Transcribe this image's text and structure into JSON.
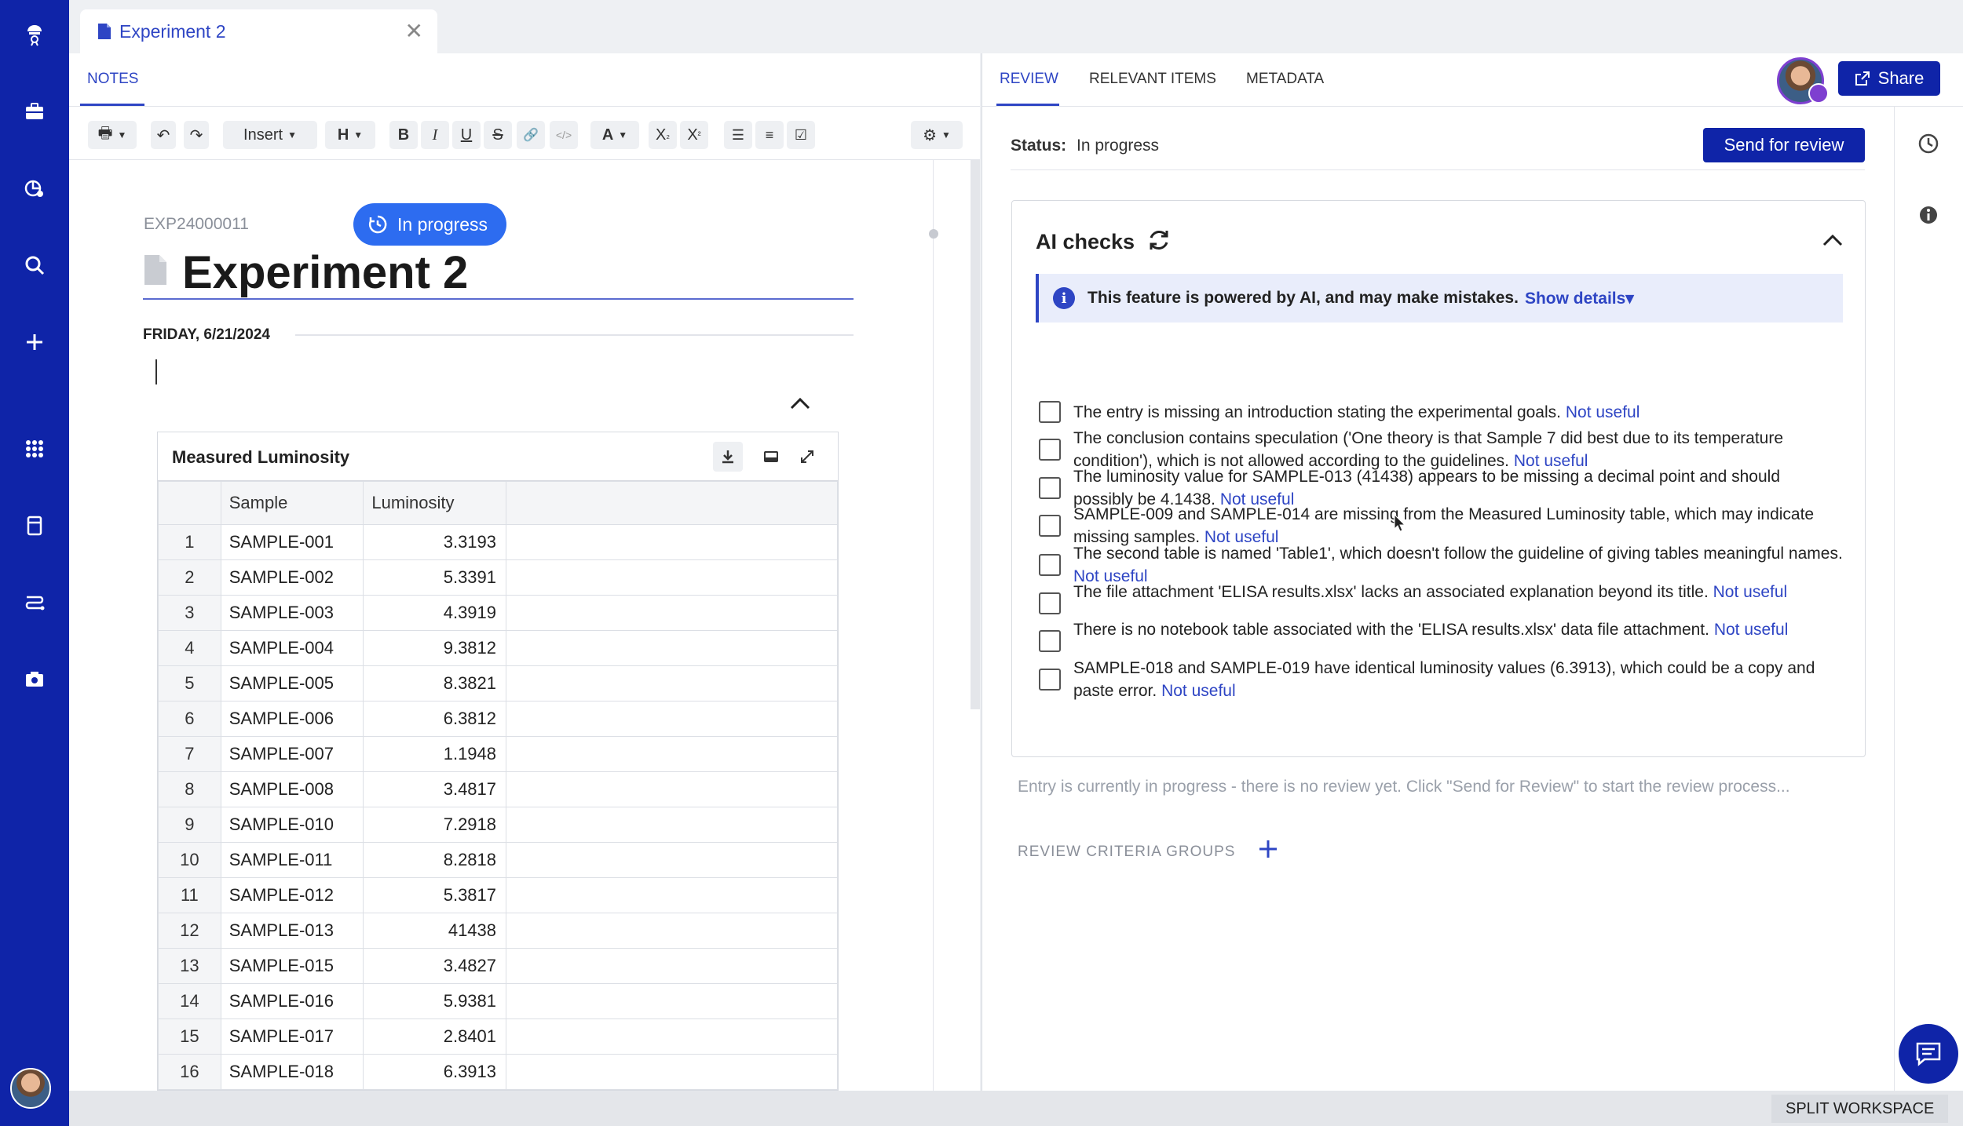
{
  "tab": {
    "title": "Experiment 2"
  },
  "notes": {
    "tab_label": "NOTES",
    "toolbar": {
      "insert_label": "Insert",
      "heading_label": "H",
      "font_color_label": "A"
    },
    "experiment_id": "EXP24000011",
    "status_pill": "In progress",
    "title": "Experiment 2",
    "date_label": "FRIDAY, 6/21/2024",
    "table": {
      "title": "Measured Luminosity",
      "columns": [
        "Sample",
        "Luminosity"
      ],
      "rows": [
        {
          "n": "1",
          "sample": "SAMPLE-001",
          "lum": "3.3193"
        },
        {
          "n": "2",
          "sample": "SAMPLE-002",
          "lum": "5.3391"
        },
        {
          "n": "3",
          "sample": "SAMPLE-003",
          "lum": "4.3919"
        },
        {
          "n": "4",
          "sample": "SAMPLE-004",
          "lum": "9.3812"
        },
        {
          "n": "5",
          "sample": "SAMPLE-005",
          "lum": "8.3821"
        },
        {
          "n": "6",
          "sample": "SAMPLE-006",
          "lum": "6.3812"
        },
        {
          "n": "7",
          "sample": "SAMPLE-007",
          "lum": "1.1948"
        },
        {
          "n": "8",
          "sample": "SAMPLE-008",
          "lum": "3.4817"
        },
        {
          "n": "9",
          "sample": "SAMPLE-010",
          "lum": "7.2918"
        },
        {
          "n": "10",
          "sample": "SAMPLE-011",
          "lum": "8.2818"
        },
        {
          "n": "11",
          "sample": "SAMPLE-012",
          "lum": "5.3817"
        },
        {
          "n": "12",
          "sample": "SAMPLE-013",
          "lum": "41438"
        },
        {
          "n": "13",
          "sample": "SAMPLE-015",
          "lum": "3.4827"
        },
        {
          "n": "14",
          "sample": "SAMPLE-016",
          "lum": "5.9381"
        },
        {
          "n": "15",
          "sample": "SAMPLE-017",
          "lum": "2.8401"
        },
        {
          "n": "16",
          "sample": "SAMPLE-018",
          "lum": "6.3913"
        }
      ]
    }
  },
  "review": {
    "tabs": [
      "REVIEW",
      "RELEVANT ITEMS",
      "METADATA"
    ],
    "share_label": "Share",
    "status_label": "Status:",
    "status_value": "In progress",
    "send_label": "Send for review",
    "ai": {
      "title": "AI checks",
      "banner_text": "This feature is powered by AI, and may make mistakes.",
      "banner_link": "Show details",
      "items": [
        {
          "text": "The entry is missing an introduction stating the experimental goals.",
          "link": "Not useful"
        },
        {
          "text": "The conclusion contains speculation ('One theory is that Sample 7 did best due to its temperature condition'), which is not allowed according to the guidelines.",
          "link": "Not useful"
        },
        {
          "text": "The luminosity value for SAMPLE-013 (41438) appears to be missing a decimal point and should possibly be 4.1438.",
          "link": "Not useful"
        },
        {
          "text": "SAMPLE-009 and SAMPLE-014 are missing from the Measured Luminosity table, which may indicate missing samples.",
          "link": "Not useful"
        },
        {
          "text": "The second table is named 'Table1', which doesn't follow the guideline of giving tables meaningful names.",
          "link": "Not useful"
        },
        {
          "text": "The file attachment 'ELISA results.xlsx' lacks an associated explanation beyond its title.",
          "link": "Not useful"
        },
        {
          "text": "There is no notebook table associated with the 'ELISA results.xlsx' data file attachment.",
          "link": "Not useful"
        },
        {
          "text": "SAMPLE-018 and SAMPLE-019 have identical luminosity values (6.3913), which could be a copy and paste error.",
          "link": "Not useful"
        }
      ]
    },
    "no_review_text": "Entry is currently in progress - there is no review yet. Click \"Send for Review\" to start the review process...",
    "criteria_label": "REVIEW CRITERIA GROUPS"
  },
  "footer": {
    "split_label": "SPLIT WORKSPACE"
  },
  "colors": {
    "nav": "#0f24a8",
    "accent": "#2e45c4",
    "pill": "#2d6cf0"
  }
}
